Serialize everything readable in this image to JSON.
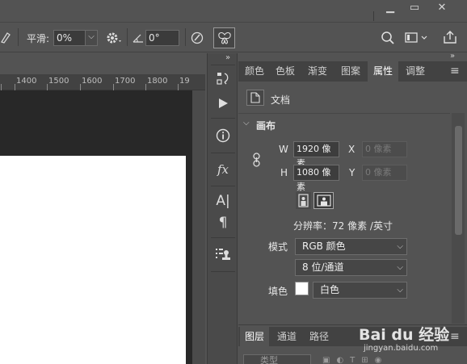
{
  "window": {
    "minimize": "▁",
    "maximize": "▭",
    "close": "✕"
  },
  "options_bar": {
    "smooth_label": "平滑:",
    "smooth_value": "0%",
    "angle_value": "0°"
  },
  "ruler_ticks": [
    "1400",
    "1500",
    "1600",
    "1700",
    "1800",
    "19"
  ],
  "panel_tabs": [
    "颜色",
    "色板",
    "渐变",
    "图案",
    "属性",
    "调整"
  ],
  "properties": {
    "doc_label": "文档",
    "section_title": "画布",
    "width_label": "W",
    "width_value": "1920 像素",
    "height_label": "H",
    "height_value": "1080 像素",
    "x_label": "X",
    "x_value": "0 像素",
    "y_label": "Y",
    "y_value": "0 像素",
    "resolution": "分辨率：72 像素 /英寸",
    "mode_label": "模式",
    "mode_value": "RGB 颜色",
    "depth_value": "8 位/通道",
    "fill_label": "填色",
    "fill_value": "白色"
  },
  "layers_tabs": [
    "图层",
    "通道",
    "路径"
  ],
  "layers_search": "类型",
  "watermark": {
    "brand": "Bai du 经验",
    "url": "jingyan.baidu.com"
  },
  "colors": {
    "active_tab": "#535353",
    "fill_swatch": "#ffffff"
  }
}
